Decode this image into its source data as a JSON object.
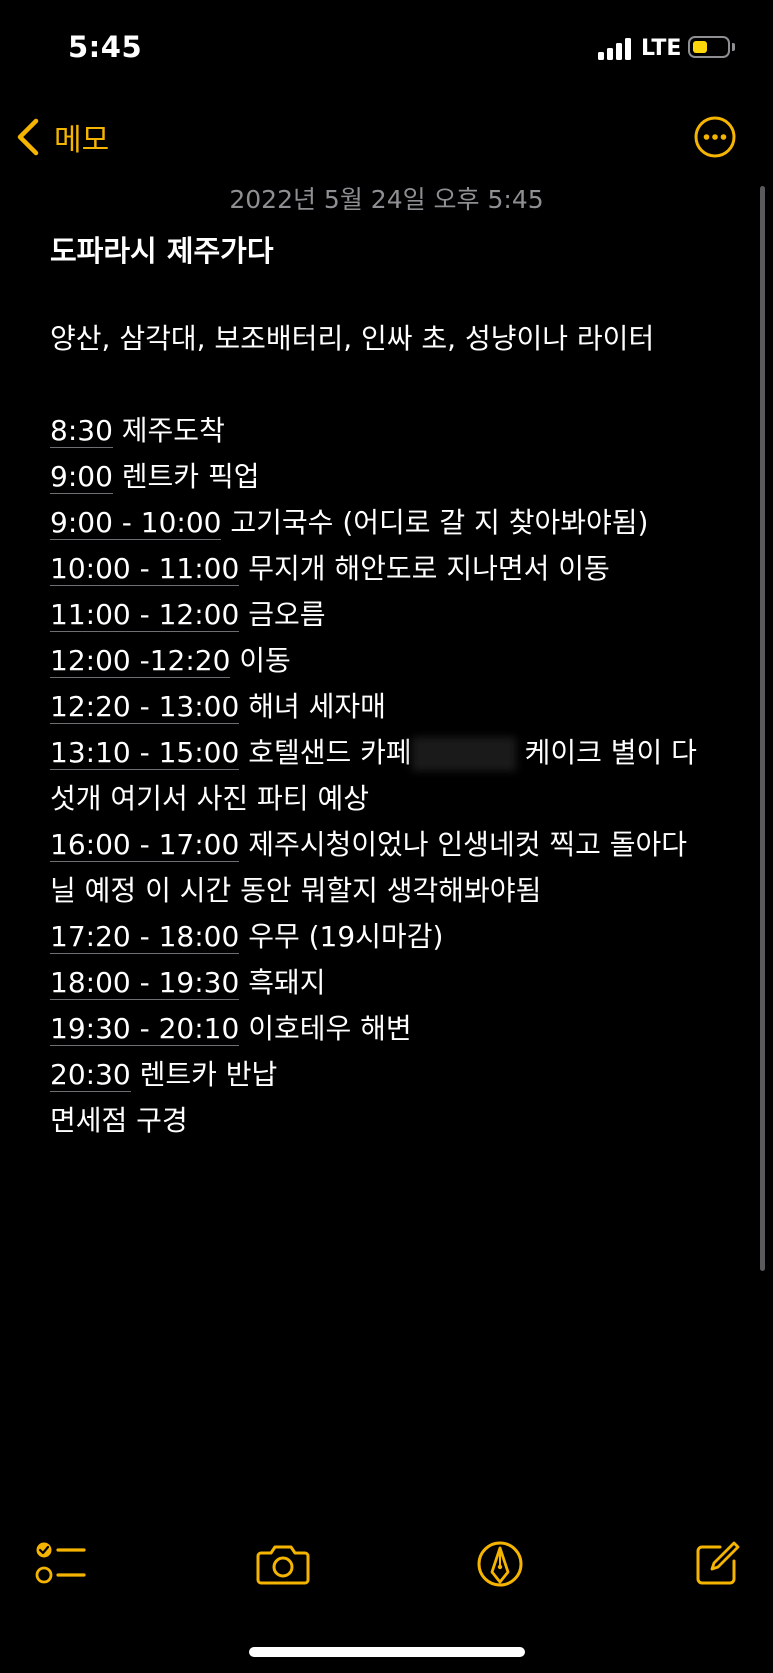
{
  "status_bar": {
    "time": "5:45",
    "network": "LTE",
    "battery_color": "#ffd60a",
    "battery_level": 0.4
  },
  "nav": {
    "back_label": "메모",
    "back_icon": "chevron-left-icon",
    "more_icon": "ellipsis-circle-icon",
    "accent_color": "#f4b400"
  },
  "note": {
    "date": "2022년 5월 24일 오후 5:45",
    "title": "도파라시 제주가다",
    "items_line": "양산, 삼각대, 보조배터리, 인싸 초, 성냥이나 라이터",
    "schedule": [
      {
        "time": "8:30",
        "text": " 제주도착"
      },
      {
        "time": "9:00",
        "text": " 렌트카 픽업"
      },
      {
        "time": "9:00 - 10:00",
        "text": " 고기국수 (어디로 갈 지 찾아봐야됨)"
      },
      {
        "time": "10:00 - 11:00",
        "text": " 무지개 해안도로 지나면서 이동"
      },
      {
        "time": "11:00 - 12:00",
        "text": " 금오름"
      },
      {
        "time": "12:00 -12:20",
        "text": " 이동"
      },
      {
        "time": "12:20 - 13:00",
        "text": " 해녀 세자매"
      },
      {
        "time": "13:10 - 15:00",
        "text": " 호텔샌드 카페",
        "text_after_blur": " 케이크 별이 다"
      },
      {
        "time": "",
        "text": "섯개 여기서 사진 파티 예상"
      },
      {
        "time": "16:00 - 17:00",
        "text": " 제주시청이었나 인생네컷 찍고 돌아다"
      },
      {
        "time": "",
        "text": "닐 예정 이 시간 동안 뭐할지 생각해봐야됨"
      },
      {
        "time": "17:20 - 18:00",
        "text": " 우무 (19시마감)"
      },
      {
        "time": "18:00 - 19:30",
        "text": " 흑돼지"
      },
      {
        "time": "19:30 - 20:10",
        "text": " 이호테우 해변"
      },
      {
        "time": "20:30",
        "text": " 렌트카 반납"
      },
      {
        "time": "",
        "text": "면세점 구경"
      }
    ]
  },
  "toolbar": {
    "checklist_icon": "checklist-icon",
    "camera_icon": "camera-icon",
    "markup_icon": "markup-pen-icon",
    "compose_icon": "compose-icon"
  }
}
